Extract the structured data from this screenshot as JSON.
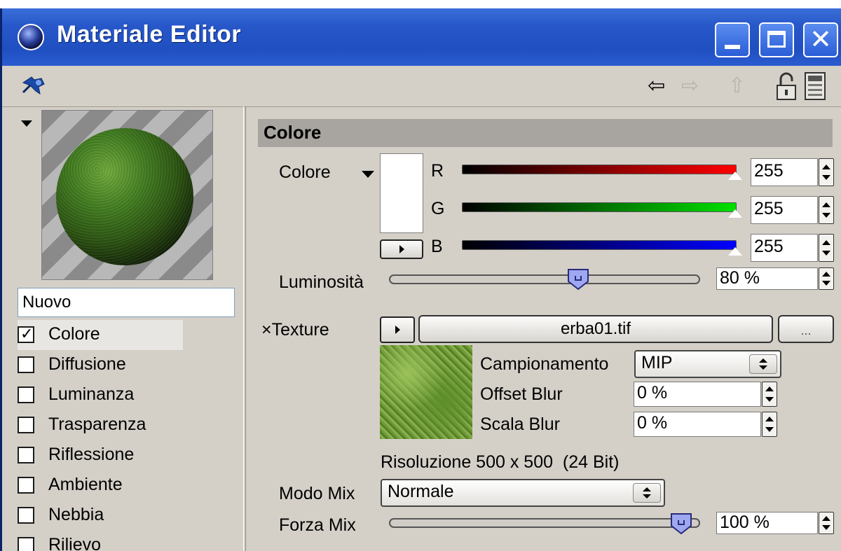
{
  "window": {
    "title": "Materiale Editor"
  },
  "material": {
    "name": "Nuovo"
  },
  "channels": [
    {
      "label": "Colore",
      "checked": true
    },
    {
      "label": "Diffusione",
      "checked": false
    },
    {
      "label": "Luminanza",
      "checked": false
    },
    {
      "label": "Trasparenza",
      "checked": false
    },
    {
      "label": "Riflessione",
      "checked": false
    },
    {
      "label": "Ambiente",
      "checked": false
    },
    {
      "label": "Nebbia",
      "checked": false
    },
    {
      "label": "Rilievo",
      "checked": false
    }
  ],
  "section": {
    "title": "Colore"
  },
  "color": {
    "label": "Colore",
    "r_label": "R",
    "g_label": "G",
    "b_label": "B",
    "r": "255",
    "g": "255",
    "b": "255",
    "swatch_hex": "#ffffff"
  },
  "luminosity": {
    "label": "Luminosità",
    "value": "80 %",
    "fraction": 0.8
  },
  "texture": {
    "label": "Texture",
    "prefix": "×",
    "file": "erba01.tif",
    "browse": "...",
    "sampling_label": "Campionamento",
    "sampling_value": "MIP",
    "offset_blur_label": "Offset Blur",
    "offset_blur_value": "0 %",
    "scale_blur_label": "Scala Blur",
    "scale_blur_value": "0 %",
    "resolution": "Risoluzione 500 x 500  (24 Bit)"
  },
  "mix": {
    "mode_label": "Modo Mix",
    "mode_value": "Normale",
    "strength_label": "Forza Mix",
    "strength_value": "100 %",
    "strength_fraction": 1.0
  },
  "icons": {
    "window_icon": "material-sphere-icon",
    "pin": "pin-icon",
    "back": "arrow-left-icon",
    "forward": "arrow-right-icon",
    "up": "arrow-up-icon",
    "lock": "lock-icon",
    "calculator": "calculator-icon"
  }
}
